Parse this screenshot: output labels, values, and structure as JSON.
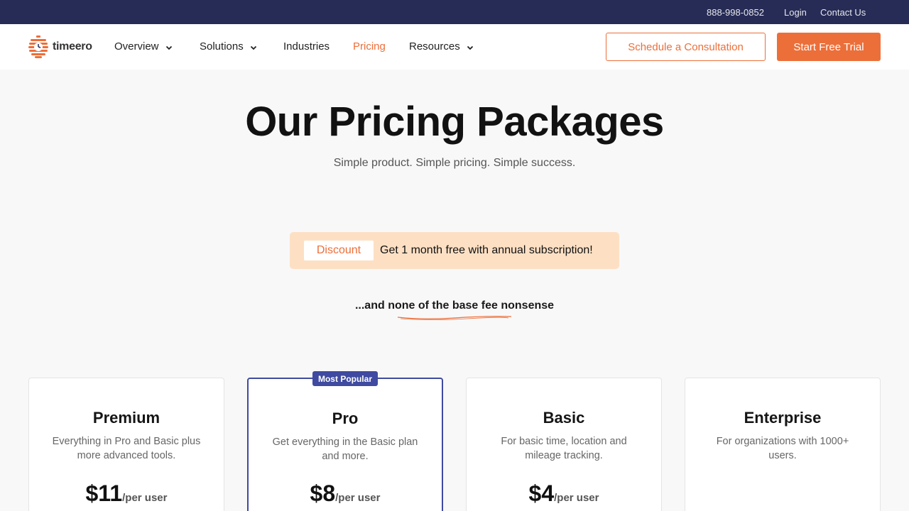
{
  "topbar": {
    "phone": "888-998-0852",
    "login": "Login",
    "contact": "Contact Us"
  },
  "nav": {
    "logo_text": "timeero",
    "items": [
      {
        "label": "Overview",
        "dropdown": true
      },
      {
        "label": "Solutions",
        "dropdown": true
      },
      {
        "label": "Industries",
        "dropdown": false
      },
      {
        "label": "Pricing",
        "dropdown": false,
        "active": true
      },
      {
        "label": "Resources",
        "dropdown": true
      }
    ],
    "consult_button": "Schedule a Consultation",
    "trial_button": "Start Free Trial"
  },
  "hero": {
    "title": "Our Pricing Packages",
    "subtitle": "Simple product. Simple pricing. Simple success."
  },
  "discount": {
    "tag": "Discount",
    "text": "Get 1 month free with annual subscription!"
  },
  "tagline": {
    "prefix": "...and ",
    "emphasis": "none of the base fee nonsense"
  },
  "plans": [
    {
      "name": "Premium",
      "description": "Everything in Pro and Basic plus more advanced tools.",
      "price": "$11",
      "unit": "/per user"
    },
    {
      "name": "Pro",
      "badge": "Most Popular",
      "description": "Get everything in the Basic plan and more.",
      "price": "$8",
      "unit": "/per user"
    },
    {
      "name": "Basic",
      "description": "For basic time, location and mileage tracking.",
      "price": "$4",
      "unit": "/per user"
    },
    {
      "name": "Enterprise",
      "description": "For organizations with 1000+ users.",
      "price": "",
      "unit": ""
    }
  ],
  "colors": {
    "brand_orange": "#ec6f3a",
    "topbar_navy": "#272c56",
    "popular_blue": "#3f4aa0",
    "discount_bg": "#fde0c4"
  }
}
